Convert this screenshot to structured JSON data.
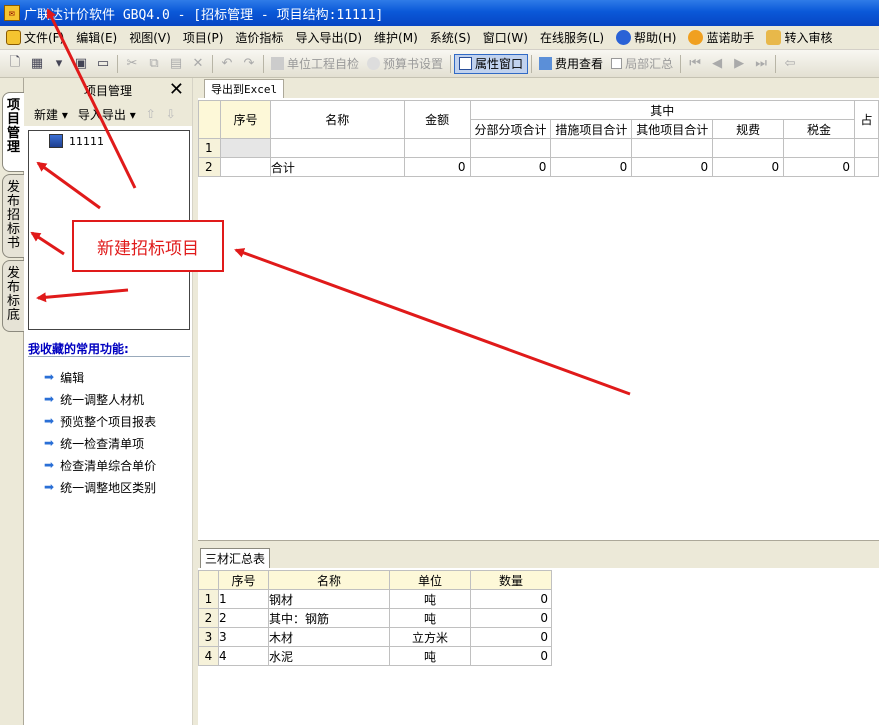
{
  "window": {
    "title": "广联达计价软件 GBQ4.0 - [招标管理 - 项目结构:11111]"
  },
  "menu": [
    {
      "label": "文件(F)",
      "icon": "file-menu-icon"
    },
    {
      "label": "编辑(E)"
    },
    {
      "label": "视图(V)"
    },
    {
      "label": "项目(P)"
    },
    {
      "label": "造价指标"
    },
    {
      "label": "导入导出(D)"
    },
    {
      "label": "维护(M)"
    },
    {
      "label": "系统(S)"
    },
    {
      "label": "窗口(W)"
    },
    {
      "label": "在线服务(L)"
    },
    {
      "label": "帮助(H)",
      "icon": "help-icon"
    },
    {
      "label": "蓝诺助手",
      "icon": "assistant-icon"
    },
    {
      "label": "转入审核",
      "icon": "audit-icon"
    }
  ],
  "toolbar": {
    "unit_check": "单位工程自检",
    "budget_settings": "预算书设置",
    "property_window": "属性窗口",
    "fee_view": "费用查看",
    "local_summary": "局部汇总"
  },
  "left_tabs": [
    "项目管理",
    "发布招标书",
    "发布标底"
  ],
  "left_panel": {
    "title": "项目管理",
    "new_label": "新建",
    "import_export_label": "导入导出",
    "tree_node": "11111",
    "favorites_title": "我收藏的常用功能:",
    "favorites": [
      "编辑",
      "统一调整人材机",
      "预览整个项目报表",
      "统一检查清单项",
      "检查清单综合单价",
      "统一调整地区类别"
    ]
  },
  "main": {
    "tab_label": "导出到Excel",
    "grid_headers": {
      "seq": "序号",
      "name": "名称",
      "amount": "金额",
      "group": "其中",
      "sub": [
        "分部分项合计",
        "措施项目合计",
        "其他项目合计",
        "规费",
        "税金"
      ],
      "extra": "占"
    },
    "rows": [
      {
        "rn": "1",
        "seq": "",
        "name": "",
        "amount": "",
        "vals": [
          "",
          "",
          "",
          "",
          ""
        ]
      },
      {
        "rn": "2",
        "seq": "",
        "name": "合计",
        "amount": "0",
        "vals": [
          "0",
          "0",
          "0",
          "0",
          "0"
        ]
      }
    ]
  },
  "bottom": {
    "tab_label": "三材汇总表",
    "headers": {
      "seq": "序号",
      "name": "名称",
      "unit": "单位",
      "qty": "数量"
    },
    "rows": [
      {
        "rn": "1",
        "seq": "1",
        "name": "钢材",
        "unit": "吨",
        "qty": "0"
      },
      {
        "rn": "2",
        "seq": "2",
        "name": "其中：钢筋",
        "unit": "吨",
        "qty": "0"
      },
      {
        "rn": "3",
        "seq": "3",
        "name": "木材",
        "unit": "立方米",
        "qty": "0"
      },
      {
        "rn": "4",
        "seq": "4",
        "name": "水泥",
        "unit": "吨",
        "qty": "0"
      }
    ]
  },
  "annotation": {
    "label": "新建招标项目",
    "color": "#e01a1a"
  }
}
